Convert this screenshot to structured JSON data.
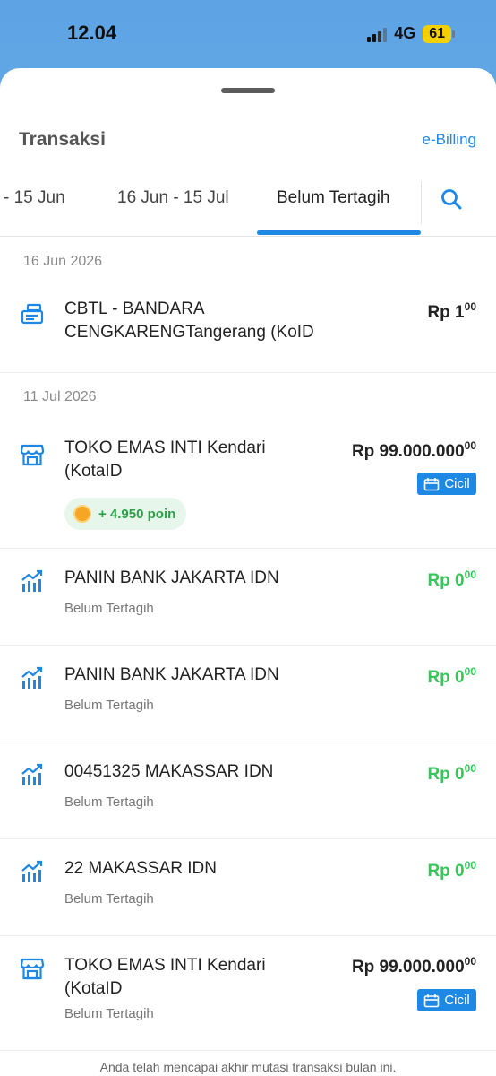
{
  "status_bar": {
    "time": "12.04",
    "network": "4G",
    "battery": "61"
  },
  "sheet": {
    "title": "Transaksi",
    "ebilling_label": "e-Billing",
    "tabs": [
      {
        "label": "- 15 Jun"
      },
      {
        "label": "16 Jun - 15 Jul"
      },
      {
        "label": "Belum Tertagih"
      }
    ],
    "active_tab": "Belum Tertagih"
  },
  "groups": [
    {
      "date": "16 Jun 2026"
    },
    {
      "date": "11 Jul 2026"
    }
  ],
  "transactions": [
    {
      "icon": "receipt-icon",
      "title_line1": "CBTL - BANDARA",
      "title_line2": "CENGKARENGTangerang (KoID",
      "amount_main": "Rp 1",
      "amount_cents": "00",
      "amount_color": "#222222"
    },
    {
      "icon": "store-icon",
      "title_line1": "TOKO EMAS INTI Kendari",
      "title_line2": "(KotaID",
      "amount_main": "Rp 99.000.000",
      "amount_cents": "00",
      "poin": "+ 4.950 poin",
      "cicil": "Cicil"
    },
    {
      "icon": "chart-icon",
      "title_line1": "PANIN BANK JAKARTA IDN",
      "subtitle": "Belum Tertagih",
      "amount_main": "Rp 0",
      "amount_cents": "00",
      "amount_color": "#34c759"
    },
    {
      "icon": "chart-icon",
      "title_line1": "PANIN BANK JAKARTA IDN",
      "subtitle": "Belum Tertagih",
      "amount_main": "Rp 0",
      "amount_cents": "00",
      "amount_color": "#34c759"
    },
    {
      "icon": "chart-icon",
      "title_line1": "00451325 MAKASSAR IDN",
      "subtitle": "Belum Tertagih",
      "amount_main": "Rp 0",
      "amount_cents": "00",
      "amount_color": "#34c759"
    },
    {
      "icon": "chart-icon",
      "title_line1": "22 MAKASSAR IDN",
      "subtitle": "Belum Tertagih",
      "amount_main": "Rp 0",
      "amount_cents": "00",
      "amount_color": "#34c759"
    },
    {
      "icon": "store-icon",
      "title_line1": "TOKO EMAS INTI Kendari",
      "title_line2": "(KotaID",
      "subtitle": "Belum Tertagih",
      "amount_main": "Rp 99.000.000",
      "amount_cents": "00",
      "cicil": "Cicil"
    }
  ],
  "footer_note": "Anda telah mencapai akhir mutasi transaksi bulan ini.",
  "colors": {
    "accent": "#1e88e5",
    "positive": "#34c759",
    "battery": "#f5d000"
  }
}
